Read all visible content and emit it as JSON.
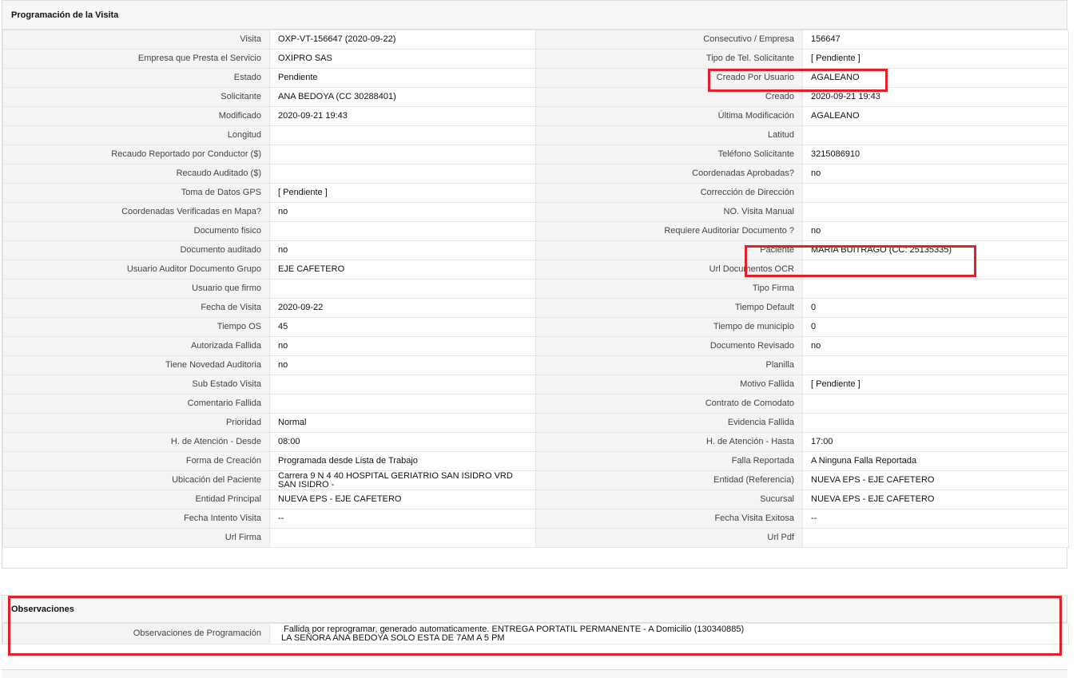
{
  "section1": {
    "title": "Programación de la Visita",
    "rows": [
      [
        "Visita",
        "OXP-VT-156647 (2020-09-22)",
        "Consecutivo / Empresa",
        "156647"
      ],
      [
        "Empresa que Presta el Servicio",
        "OXIPRO SAS",
        "Tipo de Tel. Solicitante",
        "[ Pendiente ]"
      ],
      [
        "Estado",
        "Pendiente",
        "Creado Por Usuario",
        "AGALEANO"
      ],
      [
        "Solicitante",
        "ANA BEDOYA (CC 30288401)",
        "Creado",
        "2020-09-21 19:43"
      ],
      [
        "Modificado",
        "2020-09-21 19:43",
        "Última Modificación",
        " AGALEANO"
      ],
      [
        "Longitud",
        "",
        "Latitud",
        ""
      ],
      [
        "Recaudo Reportado por Conductor ($)",
        "",
        "Teléfono Solicitante",
        "3215086910"
      ],
      [
        "Recaudo Auditado ($)",
        "",
        "Coordenadas Aprobadas?",
        " no"
      ],
      [
        "Toma de Datos GPS",
        "[ Pendiente ]",
        "Corrección de Dirección",
        ""
      ],
      [
        "Coordenadas Verificadas en Mapa?",
        " no",
        "NO. Visita Manual",
        ""
      ],
      [
        "Documento fisico",
        "",
        "Requiere Auditoriar Documento ?",
        " no"
      ],
      [
        "Documento auditado",
        " no",
        "Paciente",
        "MARIA BUITRAGO (CC: 25135335)"
      ],
      [
        "Usuario Auditor Documento Grupo",
        "EJE CAFETERO",
        "Url Documentos OCR",
        ""
      ],
      [
        "Usuario que firmo",
        "",
        "Tipo Firma",
        ""
      ],
      [
        "Fecha de Visita",
        " 2020-09-22",
        "Tiempo Default",
        "0"
      ],
      [
        "Tiempo OS",
        "45",
        "Tiempo de municipio",
        "0"
      ],
      [
        "Autorizada Fallida",
        " no",
        "Documento Revisado",
        " no"
      ],
      [
        "Tiene Novedad Auditoria",
        " no",
        "Planilla",
        ""
      ],
      [
        "Sub Estado Visita",
        "",
        "Motivo Fallida",
        "[ Pendiente ]"
      ],
      [
        "Comentario Fallida",
        "",
        "Contrato de Comodato",
        ""
      ],
      [
        "Prioridad",
        "Normal",
        "Evidencia Fallida",
        ""
      ],
      [
        "H. de Atención - Desde",
        "08:00",
        "H. de Atención - Hasta",
        "17:00"
      ],
      [
        "Forma de Creación",
        "Programada desde Lista de Trabajo",
        "Falla Reportada",
        "A Ninguna Falla Reportada"
      ],
      [
        "Ubicación del Paciente",
        "Carrera 9 N 4 40 HOSPITAL GERIATRIO SAN ISIDRO VRD SAN ISIDRO -",
        "Entidad (Referencia)",
        "NUEVA EPS - EJE CAFETERO"
      ],
      [
        "Entidad Principal",
        "NUEVA EPS - EJE CAFETERO",
        "Sucursal",
        "NUEVA EPS - EJE CAFETERO"
      ],
      [
        "Fecha Intento Visita",
        " --",
        "Fecha Visita Exitosa",
        " --"
      ],
      [
        "Url Firma",
        "",
        "Url Pdf",
        ""
      ]
    ]
  },
  "section2": {
    "title": "Observaciones",
    "label": "Observaciones de Programación",
    "line1": "Fallida por reprogramar, generado automaticamente. ENTREGA PORTATIL PERMANENTE - A Domicilio (130340885)",
    "line2": "LA SEÑORA ANA BEDOYA SOLO ESTA DE 7AM A 5 PM"
  },
  "colors": {
    "highlight": "#e0202a",
    "label_bg": "#f4f4f4",
    "header_bg": "#f7f7f7"
  }
}
